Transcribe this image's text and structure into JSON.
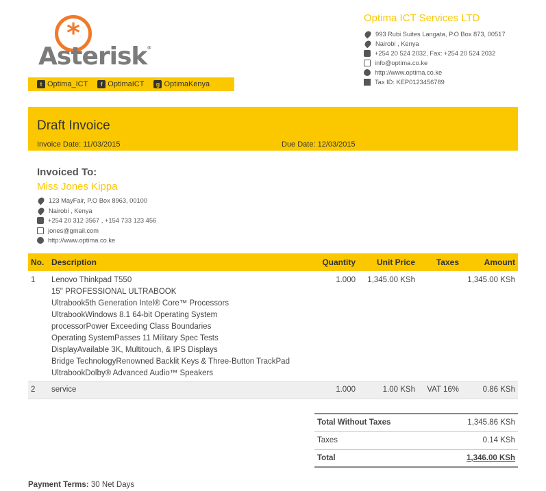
{
  "logo": {
    "brand": "Asterisk",
    "mark": "*",
    "tm": "®"
  },
  "social": {
    "twitter": {
      "icon": "twitter-icon",
      "label": "Optima_ICT"
    },
    "facebook": {
      "icon": "facebook-icon",
      "label": "OptimaICT"
    },
    "gplus": {
      "icon": "google-plus-icon",
      "label": "OptimaKenya"
    }
  },
  "company": {
    "name": "Optima ICT Services LTD",
    "address": "993 Rubi Suites Langata, P.O Box 873, 00517",
    "city": "Nairobi , Kenya",
    "phone": "+254 20 524 2032, Fax: +254 20 524 2032",
    "email": "info@optima.co.ke",
    "website": "http://www.optima.co.ke",
    "tax_id": "Tax ID: KEP0123456789"
  },
  "invoice": {
    "title": "Draft Invoice",
    "invoice_date": "Invoice Date: 11/03/2015",
    "due_date": "Due Date: 12/03/2015"
  },
  "customer": {
    "label": "Invoiced To:",
    "name": "Miss Jones Kippa",
    "address": "123 MayFair, P.O Box 8963, 00100",
    "city": "Nairobi , Kenya",
    "phone": "+254 20 312 3567 , +154 733 123 456",
    "email": "jones@gmail.com",
    "website": "http://www.optima.co.ke"
  },
  "table": {
    "headers": [
      "No.",
      "Description",
      "Quantity",
      "Unit Price",
      "Taxes",
      "Amount"
    ],
    "rows": [
      {
        "no": "1",
        "description": [
          "Lenovo Thinkpad T550",
          "15\" PROFESSIONAL ULTRABOOK",
          "Ultrabook5th Generation Intel® Core™ Processors",
          "UltrabookWindows 8.1 64-bit Operating System",
          "processorPower Exceeding Class Boundaries",
          "Operating SystemPasses 11 Military Spec Tests",
          "DisplayAvailable 3K, Multitouch, & IPS Displays",
          "Bridge TechnologyRenowned Backlit Keys & Three-Button TrackPad",
          "UltrabookDolby® Advanced Audio™ Speakers"
        ],
        "quantity": "1.000",
        "unit_price": "1,345.00 KSh",
        "taxes": "",
        "amount": "1,345.00 KSh"
      },
      {
        "no": "2",
        "description": [
          "service"
        ],
        "quantity": "1.000",
        "unit_price": "1.00 KSh",
        "taxes": "VAT 16%",
        "amount": "0.86 KSh"
      }
    ]
  },
  "totals": {
    "without_taxes_label": "Total Without Taxes",
    "without_taxes_value": "1,345.86 KSh",
    "taxes_label": "Taxes",
    "taxes_value": "0.14 KSh",
    "total_label": "Total",
    "total_value": "1,346.00 KSh"
  },
  "payment": {
    "label": "Payment Terms:",
    "value": "30 Net Days"
  },
  "colors": {
    "accent": "#fbc800",
    "logo_orange": "#f07a2a",
    "text": "#555555"
  }
}
